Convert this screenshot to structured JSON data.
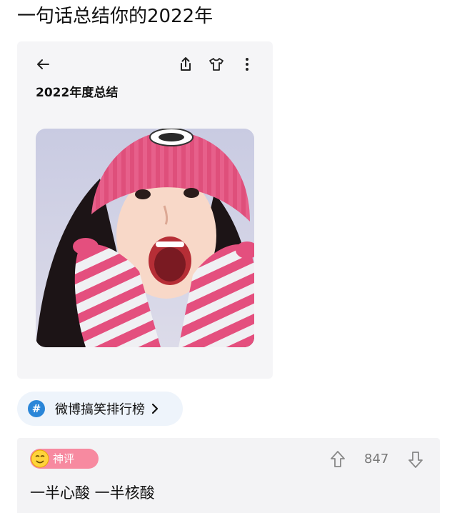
{
  "post": {
    "title": "一句话总结你的2022年"
  },
  "card": {
    "title": "2022年度总结",
    "icons": [
      "back-arrow-icon",
      "share-icon",
      "tshirt-icon",
      "more-icon"
    ],
    "image": "girl-in-pink-hat-photo"
  },
  "topic": {
    "hash": "#",
    "label": "微博搞笑排行榜"
  },
  "comment": {
    "badge_label": "神评",
    "votes": "847",
    "text": "一半心酸 一半核酸"
  },
  "colors": {
    "accent_blue": "#2a86d8",
    "badge_pink": "#f78aa0"
  }
}
